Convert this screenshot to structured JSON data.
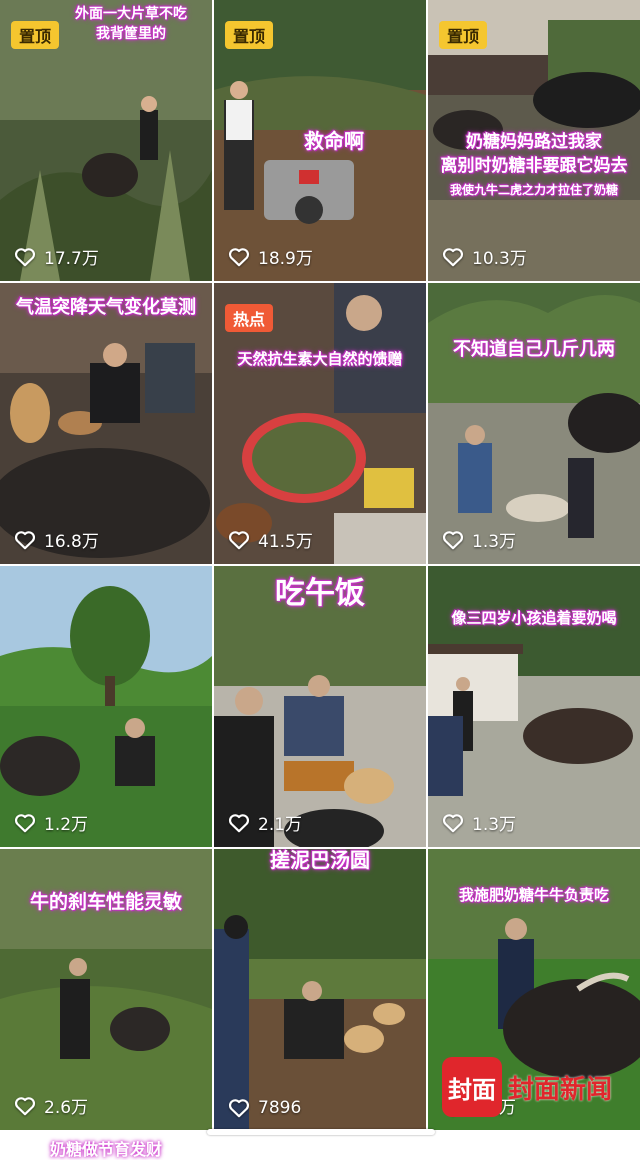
{
  "tiles": [
    {
      "caption": "外面一大片草不吃\n我背筐里的",
      "badge": "置顶",
      "likes": "17.7万"
    },
    {
      "caption": "救命啊",
      "badge": "置顶",
      "likes": "18.9万"
    },
    {
      "caption": "奶糖妈妈路过我家\n离别时奶糖非要跟它妈去",
      "caption2": "我使九牛二虎之力才拉住了奶糖",
      "badge": "置顶",
      "likes": "10.3万"
    },
    {
      "caption": "气温突降天气变化莫测",
      "likes": "16.8万"
    },
    {
      "caption": "天然抗生素大自然的馈赠",
      "badge": "热点",
      "likes": "41.5万"
    },
    {
      "caption": "不知道自己几斤几两",
      "likes": "1.3万"
    },
    {
      "caption": "",
      "likes": "1.2万"
    },
    {
      "caption": "吃午饭",
      "likes": "2.1万"
    },
    {
      "caption": "像三四岁小孩追着要奶喝",
      "likes": "1.3万"
    },
    {
      "caption": "牛的刹车性能灵敏",
      "likes": "2.6万"
    },
    {
      "caption": "搓泥巴汤圆",
      "likes": "7896"
    },
    {
      "caption": "我施肥奶糖牛牛负责吃",
      "likes": "1.6万"
    }
  ],
  "watermark": {
    "logo": "封面",
    "text": "封面新闻"
  },
  "peek_caption": "奶糖做节育发财",
  "icons": {
    "like": "heart-outline-icon"
  },
  "colors": {
    "caption_glow": "#d23bd2",
    "badge_pinned": "#f5c62f",
    "badge_hot": "#f05a36",
    "watermark": "#e0262c"
  }
}
